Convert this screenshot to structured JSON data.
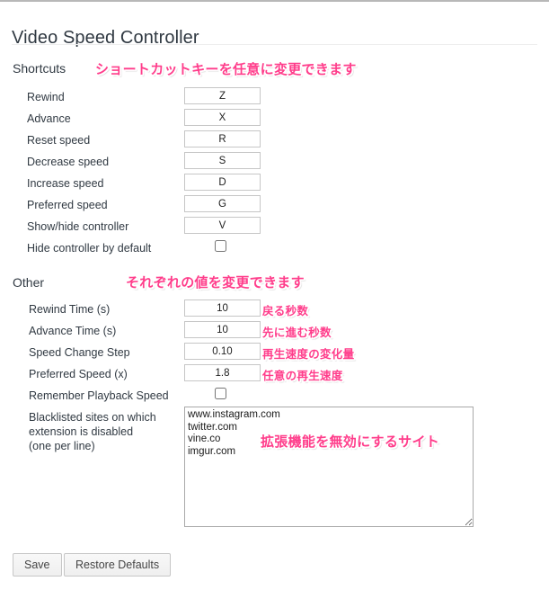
{
  "page": {
    "title": "Video Speed Controller"
  },
  "sections": {
    "shortcuts": {
      "heading": "Shortcuts",
      "annotation": "ショートカットキーを任意に変更できます",
      "rows": [
        {
          "label": "Rewind",
          "value": "Z",
          "type": "text"
        },
        {
          "label": "Advance",
          "value": "X",
          "type": "text"
        },
        {
          "label": "Reset speed",
          "value": "R",
          "type": "text"
        },
        {
          "label": "Decrease speed",
          "value": "S",
          "type": "text"
        },
        {
          "label": "Increase speed",
          "value": "D",
          "type": "text"
        },
        {
          "label": "Preferred speed",
          "value": "G",
          "type": "text"
        },
        {
          "label": "Show/hide controller",
          "value": "V",
          "type": "text"
        },
        {
          "label": "Hide controller by default",
          "value": "",
          "type": "checkbox",
          "checked": false
        }
      ]
    },
    "other": {
      "heading": "Other",
      "annotation": "それぞれの値を変更できます",
      "rows": [
        {
          "label": "Rewind Time (s)",
          "value": "10",
          "type": "text",
          "annotation": "戻る秒数"
        },
        {
          "label": "Advance Time (s)",
          "value": "10",
          "type": "text",
          "annotation": "先に進む秒数"
        },
        {
          "label": "Speed Change Step",
          "value": "0.10",
          "type": "text",
          "annotation": "再生速度の変化量"
        },
        {
          "label": "Preferred Speed (x)",
          "value": "1.8",
          "type": "text",
          "annotation": "任意の再生速度"
        },
        {
          "label": "Remember Playback Speed",
          "value": "",
          "type": "checkbox",
          "checked": false,
          "annotation": ""
        }
      ],
      "blacklist": {
        "label_line1": "Blacklisted sites on which",
        "label_line2": "extension is disabled",
        "label_line3": "(one per line)",
        "value": "www.instagram.com\ntwitter.com\nvine.co\nimgur.com",
        "annotation": "拡張機能を無効にするサイト"
      }
    }
  },
  "footer": {
    "save_label": "Save",
    "restore_label": "Restore Defaults"
  },
  "colors": {
    "annotation_pink": "#ff3d8b",
    "text": "#303942",
    "divider": "#eeeeee"
  }
}
